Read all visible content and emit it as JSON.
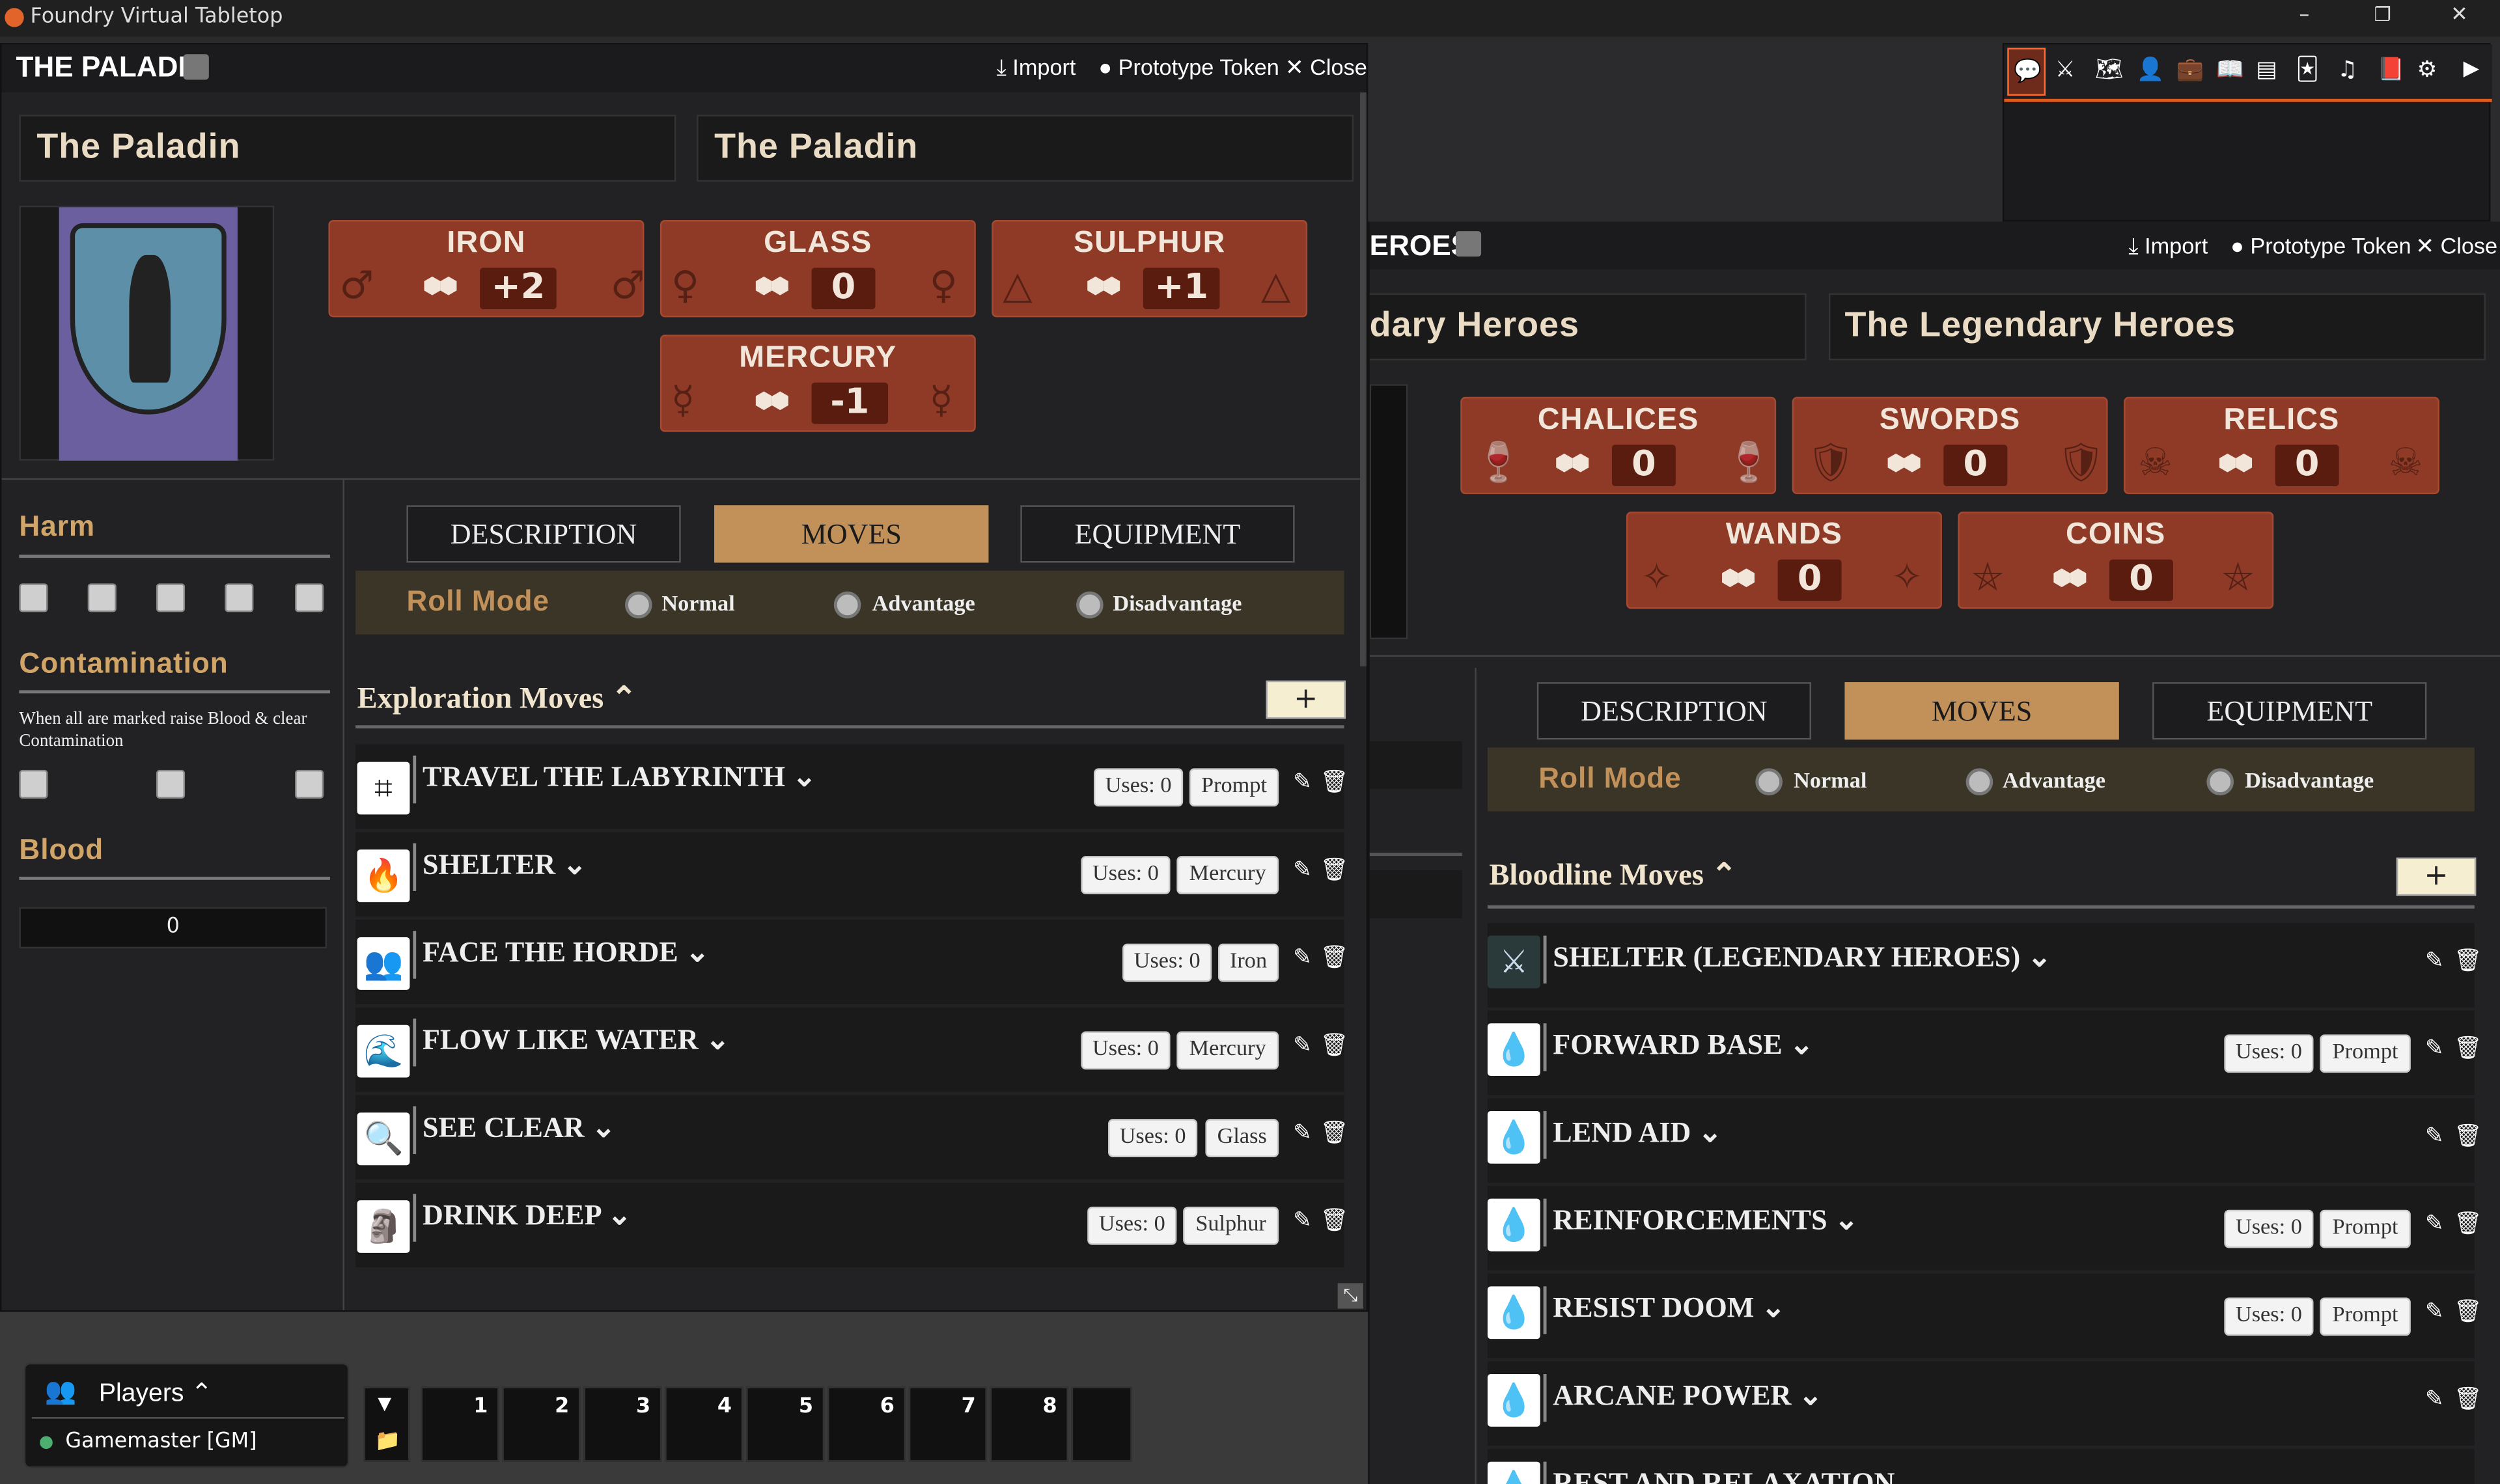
{
  "app": {
    "title": "Foundry Virtual Tabletop",
    "win_min": "–",
    "win_max": "❐",
    "win_close": "✕"
  },
  "sidebar_tabs": [
    "chat-icon",
    "combat-icon",
    "scenes-icon",
    "actors-icon",
    "items-icon",
    "journal-icon",
    "tables-icon",
    "cards-icon",
    "playlists-icon",
    "compendium-icon",
    "settings-icon",
    "collapse-icon"
  ],
  "paladin": {
    "window_title": "THE PALADIN",
    "import": "Import",
    "prototype_token": "Prototype Token",
    "close": "Close",
    "name1": "The Paladin",
    "name2": "The Paladin",
    "stats": [
      {
        "name": "IRON",
        "value": "+2"
      },
      {
        "name": "GLASS",
        "value": "0"
      },
      {
        "name": "SULPHUR",
        "value": "+1"
      },
      {
        "name": "MERCURY",
        "value": "-1"
      }
    ],
    "harm_label": "Harm",
    "contamination_label": "Contamination",
    "contamination_note": "When all are marked raise Blood & clear Contamination",
    "blood_label": "Blood",
    "blood_value": "0",
    "tabs": [
      "DESCRIPTION",
      "MOVES",
      "EQUIPMENT"
    ],
    "roll_mode": "Roll Mode",
    "roll_options": [
      "Normal",
      "Advantage",
      "Disadvantage"
    ],
    "section": "Exploration Moves",
    "add": "+",
    "moves": [
      {
        "name": "TRAVEL THE LABYRINTH",
        "uses": "Uses: 0",
        "tag": "Prompt"
      },
      {
        "name": "SHELTER",
        "uses": "Uses: 0",
        "tag": "Mercury"
      },
      {
        "name": "FACE THE HORDE",
        "uses": "Uses: 0",
        "tag": "Iron"
      },
      {
        "name": "FLOW LIKE WATER",
        "uses": "Uses: 0",
        "tag": "Mercury"
      },
      {
        "name": "SEE CLEAR",
        "uses": "Uses: 0",
        "tag": "Glass"
      },
      {
        "name": "DRINK DEEP",
        "uses": "Uses: 0",
        "tag": "Sulphur"
      }
    ]
  },
  "heroes": {
    "window_title_partial": "EROES",
    "import": "Import",
    "prototype_token": "Prototype Token",
    "close": "Close",
    "name1_partial": "dary Heroes",
    "name2": "The Legendary Heroes",
    "stats": [
      {
        "name": "CHALICES",
        "value": "0"
      },
      {
        "name": "SWORDS",
        "value": "0"
      },
      {
        "name": "RELICS",
        "value": "0"
      },
      {
        "name": "WANDS",
        "value": "0"
      },
      {
        "name": "COINS",
        "value": "0"
      }
    ],
    "tabs": [
      "DESCRIPTION",
      "MOVES",
      "EQUIPMENT"
    ],
    "roll_mode": "Roll Mode",
    "roll_options": [
      "Normal",
      "Advantage",
      "Disadvantage"
    ],
    "section": "Bloodline Moves",
    "add": "+",
    "moves": [
      {
        "name": "SHELTER (LEGENDARY HEROES)"
      },
      {
        "name": "FORWARD BASE",
        "uses": "Uses: 0",
        "tag": "Prompt"
      },
      {
        "name": "LEND AID"
      },
      {
        "name": "REINFORCEMENTS",
        "uses": "Uses: 0",
        "tag": "Prompt"
      },
      {
        "name": "RESIST DOOM",
        "uses": "Uses: 0",
        "tag": "Prompt"
      },
      {
        "name": "ARCANE POWER"
      },
      {
        "name": "REST AND RELAXATION"
      }
    ]
  },
  "players": {
    "label": "Players",
    "user": "Gamemaster [GM]"
  },
  "hotbar": [
    "1",
    "2",
    "3",
    "4",
    "5",
    "6",
    "7",
    "8"
  ]
}
